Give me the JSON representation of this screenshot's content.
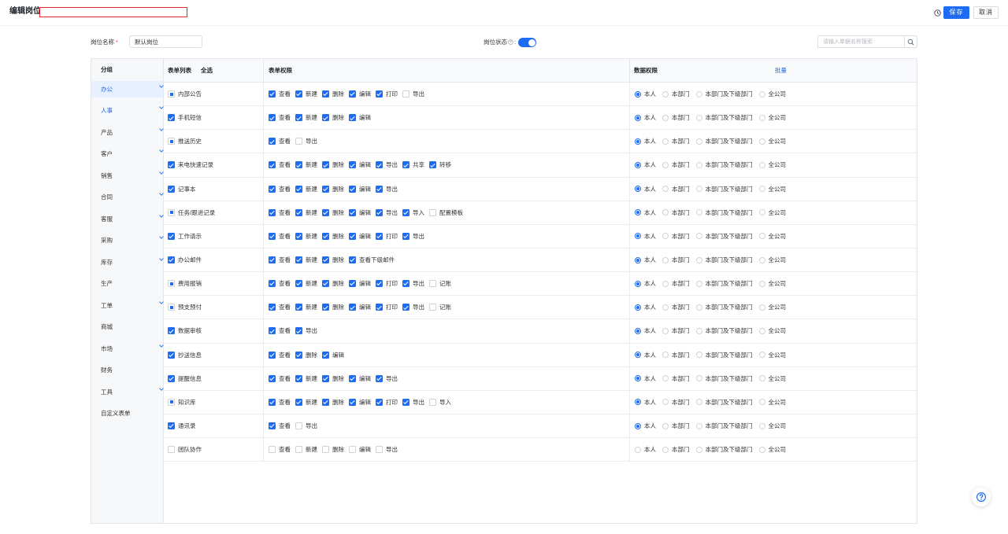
{
  "colors": {
    "accent": "#1d6cf2",
    "required": "#f53f3f",
    "title_box_border": "#e8262b"
  },
  "icons": {
    "history": "history-icon",
    "status_hint": "question-circle-icon",
    "search": "search-icon",
    "expand": "chevron-down-icon",
    "help": "help-icon"
  },
  "header": {
    "title": "编辑岗位",
    "title_input_value": "",
    "save_label": "保存",
    "cancel_label": "取消"
  },
  "form": {
    "name_label": "岗位名称",
    "required_mark": "*",
    "name_value": "默认岗位",
    "status_label": "岗位状态",
    "status_colon": ":",
    "status_enabled": true,
    "search_placeholder": "请输入单据名称搜索"
  },
  "sidebar": {
    "header": "分组",
    "items": [
      {
        "label": "办公",
        "expandable": true,
        "active": true
      },
      {
        "label": "人事",
        "expandable": true,
        "highlighted": true
      },
      {
        "label": "产品",
        "expandable": true
      },
      {
        "label": "客户",
        "expandable": true
      },
      {
        "label": "销售",
        "expandable": true
      },
      {
        "label": "合同",
        "expandable": true
      },
      {
        "label": "客服",
        "expandable": true
      },
      {
        "label": "采购",
        "expandable": true
      },
      {
        "label": "库存",
        "expandable": true
      },
      {
        "label": "生产",
        "expandable": false
      },
      {
        "label": "工单",
        "expandable": true
      },
      {
        "label": "商城",
        "expandable": false
      },
      {
        "label": "市场",
        "expandable": true
      },
      {
        "label": "财务",
        "expandable": false
      },
      {
        "label": "工具",
        "expandable": true
      },
      {
        "label": "自定义表单",
        "expandable": false
      }
    ]
  },
  "table": {
    "headers": {
      "form_list": "表单列表",
      "select_all": "全选",
      "form_permissions": "表单权限",
      "data_permissions": "数据权限",
      "batch": "批量"
    },
    "data_scope_options": [
      "本人",
      "本部门",
      "本部门及下级部门",
      "全公司"
    ],
    "rows": [
      {
        "name": "内部公告",
        "checked": false,
        "indeterminate": true,
        "perms": [
          {
            "label": "查看",
            "checked": true
          },
          {
            "label": "新建",
            "checked": true
          },
          {
            "label": "删除",
            "checked": true
          },
          {
            "label": "编辑",
            "checked": true
          },
          {
            "label": "打印",
            "checked": true
          },
          {
            "label": "导出",
            "checked": false
          }
        ],
        "scope_selected": [
          true,
          false,
          false,
          false
        ]
      },
      {
        "name": "手机短信",
        "checked": true,
        "indeterminate": false,
        "perms": [
          {
            "label": "查看",
            "checked": true
          },
          {
            "label": "新建",
            "checked": true
          },
          {
            "label": "删除",
            "checked": true
          },
          {
            "label": "编辑",
            "checked": true
          }
        ],
        "scope_selected": [
          true,
          false,
          false,
          false
        ]
      },
      {
        "name": "推送历史",
        "checked": false,
        "indeterminate": true,
        "perms": [
          {
            "label": "查看",
            "checked": true
          },
          {
            "label": "导出",
            "checked": false
          }
        ],
        "scope_selected": [
          true,
          false,
          false,
          false
        ]
      },
      {
        "name": "来电快速记录",
        "checked": true,
        "indeterminate": false,
        "perms": [
          {
            "label": "查看",
            "checked": true
          },
          {
            "label": "新建",
            "checked": true
          },
          {
            "label": "删除",
            "checked": true
          },
          {
            "label": "编辑",
            "checked": true
          },
          {
            "label": "导出",
            "checked": true
          },
          {
            "label": "共享",
            "checked": true
          },
          {
            "label": "转移",
            "checked": true
          }
        ],
        "scope_selected": [
          true,
          false,
          false,
          false
        ]
      },
      {
        "name": "记事本",
        "checked": true,
        "indeterminate": false,
        "perms": [
          {
            "label": "查看",
            "checked": true
          },
          {
            "label": "新建",
            "checked": true
          },
          {
            "label": "删除",
            "checked": true
          },
          {
            "label": "编辑",
            "checked": true
          },
          {
            "label": "导出",
            "checked": true
          }
        ],
        "scope_selected": [
          true,
          false,
          false,
          false
        ]
      },
      {
        "name": "任务/跟进记录",
        "checked": false,
        "indeterminate": true,
        "perms": [
          {
            "label": "查看",
            "checked": true
          },
          {
            "label": "新建",
            "checked": true
          },
          {
            "label": "删除",
            "checked": true
          },
          {
            "label": "编辑",
            "checked": true
          },
          {
            "label": "导出",
            "checked": true
          },
          {
            "label": "导入",
            "checked": true
          },
          {
            "label": "配置模板",
            "checked": false
          }
        ],
        "scope_selected": [
          true,
          false,
          false,
          false
        ]
      },
      {
        "name": "工作请示",
        "checked": true,
        "indeterminate": false,
        "perms": [
          {
            "label": "查看",
            "checked": true
          },
          {
            "label": "新建",
            "checked": true
          },
          {
            "label": "删除",
            "checked": true
          },
          {
            "label": "编辑",
            "checked": true
          },
          {
            "label": "打印",
            "checked": true
          },
          {
            "label": "导出",
            "checked": true
          }
        ],
        "scope_selected": [
          true,
          false,
          false,
          false
        ]
      },
      {
        "name": "办公邮件",
        "checked": true,
        "indeterminate": false,
        "perms": [
          {
            "label": "查看",
            "checked": true
          },
          {
            "label": "新建",
            "checked": true
          },
          {
            "label": "删除",
            "checked": true
          },
          {
            "label": "查看下级邮件",
            "checked": true
          }
        ],
        "scope_selected": [
          true,
          false,
          false,
          false
        ]
      },
      {
        "name": "费用报销",
        "checked": false,
        "indeterminate": true,
        "perms": [
          {
            "label": "查看",
            "checked": true
          },
          {
            "label": "新建",
            "checked": true
          },
          {
            "label": "删除",
            "checked": true
          },
          {
            "label": "编辑",
            "checked": true
          },
          {
            "label": "打印",
            "checked": true
          },
          {
            "label": "导出",
            "checked": true
          },
          {
            "label": "记账",
            "checked": false
          }
        ],
        "scope_selected": [
          true,
          false,
          false,
          false
        ]
      },
      {
        "name": "预支预付",
        "checked": false,
        "indeterminate": true,
        "perms": [
          {
            "label": "查看",
            "checked": true
          },
          {
            "label": "新建",
            "checked": true
          },
          {
            "label": "删除",
            "checked": true
          },
          {
            "label": "编辑",
            "checked": true
          },
          {
            "label": "打印",
            "checked": true
          },
          {
            "label": "导出",
            "checked": true
          },
          {
            "label": "记账",
            "checked": false
          }
        ],
        "scope_selected": [
          true,
          false,
          false,
          false
        ]
      },
      {
        "name": "数据审核",
        "checked": true,
        "indeterminate": false,
        "perms": [
          {
            "label": "查看",
            "checked": true
          },
          {
            "label": "导出",
            "checked": true
          }
        ],
        "scope_selected": [
          true,
          false,
          false,
          false
        ]
      },
      {
        "name": "抄送信息",
        "checked": true,
        "indeterminate": false,
        "perms": [
          {
            "label": "查看",
            "checked": true
          },
          {
            "label": "删除",
            "checked": true
          },
          {
            "label": "编辑",
            "checked": true
          }
        ],
        "scope_selected": [
          true,
          false,
          false,
          false
        ]
      },
      {
        "name": "提醒信息",
        "checked": true,
        "indeterminate": false,
        "perms": [
          {
            "label": "查看",
            "checked": true
          },
          {
            "label": "新建",
            "checked": true
          },
          {
            "label": "删除",
            "checked": true
          },
          {
            "label": "编辑",
            "checked": true
          },
          {
            "label": "导出",
            "checked": true
          }
        ],
        "scope_selected": [
          true,
          false,
          false,
          false
        ]
      },
      {
        "name": "知识库",
        "checked": false,
        "indeterminate": true,
        "perms": [
          {
            "label": "查看",
            "checked": true
          },
          {
            "label": "新建",
            "checked": true
          },
          {
            "label": "删除",
            "checked": true
          },
          {
            "label": "编辑",
            "checked": true
          },
          {
            "label": "打印",
            "checked": true
          },
          {
            "label": "导出",
            "checked": true
          },
          {
            "label": "导入",
            "checked": false
          }
        ],
        "scope_selected": [
          true,
          false,
          false,
          false
        ]
      },
      {
        "name": "通讯录",
        "checked": true,
        "indeterminate": false,
        "perms": [
          {
            "label": "查看",
            "checked": true
          },
          {
            "label": "导出",
            "checked": false
          }
        ],
        "scope_selected": [
          true,
          false,
          false,
          false
        ]
      },
      {
        "name": "团队协作",
        "checked": false,
        "indeterminate": false,
        "perms": [
          {
            "label": "查看",
            "checked": false
          },
          {
            "label": "新建",
            "checked": false
          },
          {
            "label": "删除",
            "checked": false
          },
          {
            "label": "编辑",
            "checked": false
          },
          {
            "label": "导出",
            "checked": false
          }
        ],
        "scope_selected": [
          false,
          false,
          false,
          false
        ]
      }
    ]
  }
}
